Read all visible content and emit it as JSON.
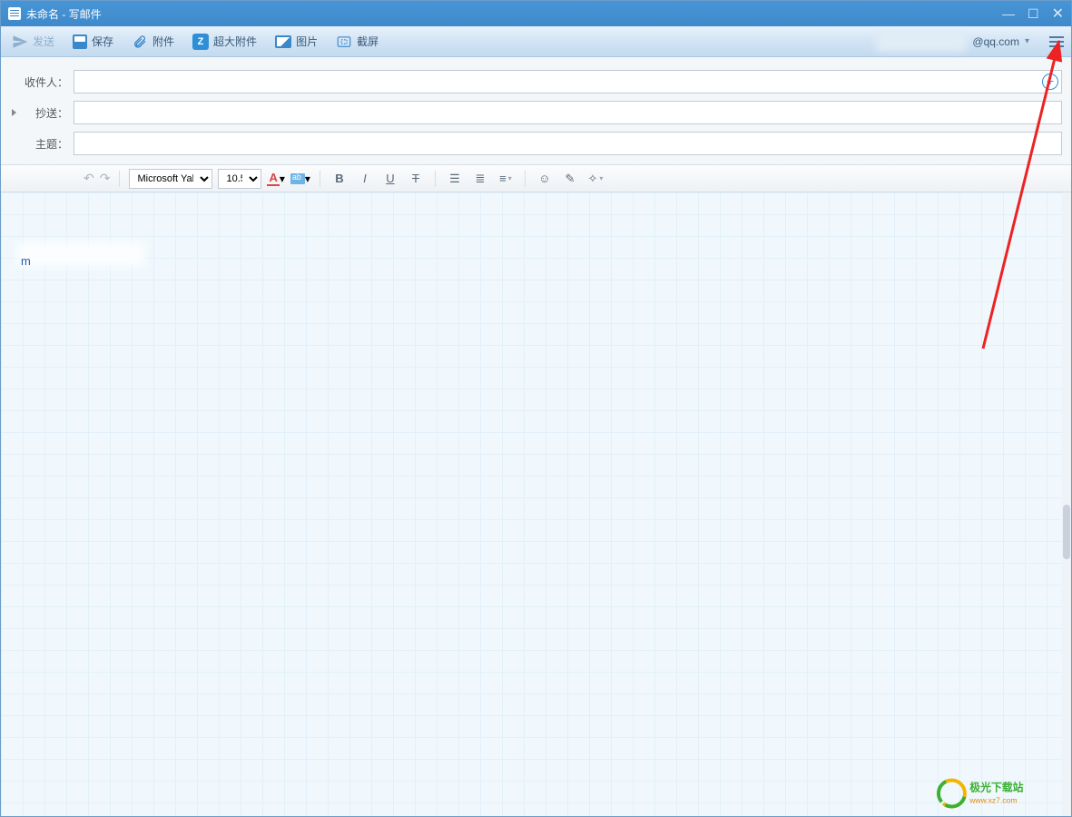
{
  "window": {
    "title": "未命名 - 写邮件"
  },
  "toolbar": {
    "send": "发送",
    "save": "保存",
    "attach": "附件",
    "bigAttach": "超大附件",
    "image": "图片",
    "screenshot": "截屏",
    "bigIconLetter": "Z"
  },
  "account": {
    "suffix": "@qq.com"
  },
  "fields": {
    "to_label": "收件人：",
    "cc_label": "抄送：",
    "subject_label": "主题：",
    "to_value": "",
    "cc_value": "",
    "subject_value": ""
  },
  "format": {
    "font": "Microsoft Yal",
    "size": "10.5"
  },
  "editor": {
    "fragment": "m"
  },
  "watermark": {
    "line1": "极光下载站",
    "line2": "www.xz7.com"
  }
}
